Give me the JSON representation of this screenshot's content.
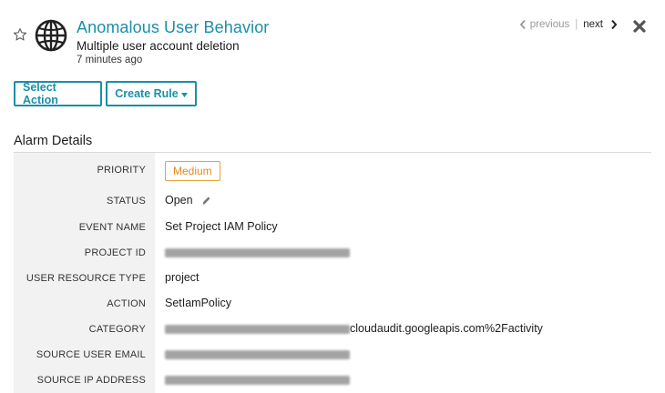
{
  "header": {
    "title": "Anomalous User Behavior",
    "subtitle": "Multiple user account deletion",
    "timestamp": "7 minutes ago",
    "pager": {
      "previous": "previous",
      "separator": "|",
      "next": "next"
    }
  },
  "actions": {
    "select_action": "Select Action",
    "create_rule": "Create Rule"
  },
  "section": {
    "title": "Alarm Details"
  },
  "details": {
    "priority": {
      "label": "PRIORITY",
      "value": "Medium"
    },
    "status": {
      "label": "STATUS",
      "value": "Open"
    },
    "event_name": {
      "label": "EVENT NAME",
      "value": "Set Project IAM Policy"
    },
    "project_id": {
      "label": "PROJECT ID"
    },
    "user_resource_type": {
      "label": "USER RESOURCE TYPE",
      "value": "project"
    },
    "action": {
      "label": "ACTION",
      "value": "SetIamPolicy"
    },
    "category": {
      "label": "CATEGORY",
      "value_suffix": "cloudaudit.googleapis.com%2Factivity"
    },
    "source_user_email": {
      "label": "SOURCE USER EMAIL"
    },
    "source_ip_address": {
      "label": "SOURCE IP ADDRESS"
    }
  },
  "colors": {
    "accent": "#1a8fa8",
    "priority_medium": "#e8a23a",
    "label_column_bg": "#f2f2f2"
  },
  "icons": [
    "star-icon",
    "globe-icon",
    "chevron-left-icon",
    "chevron-right-icon",
    "close-icon",
    "caret-down-icon",
    "pencil-icon"
  ]
}
